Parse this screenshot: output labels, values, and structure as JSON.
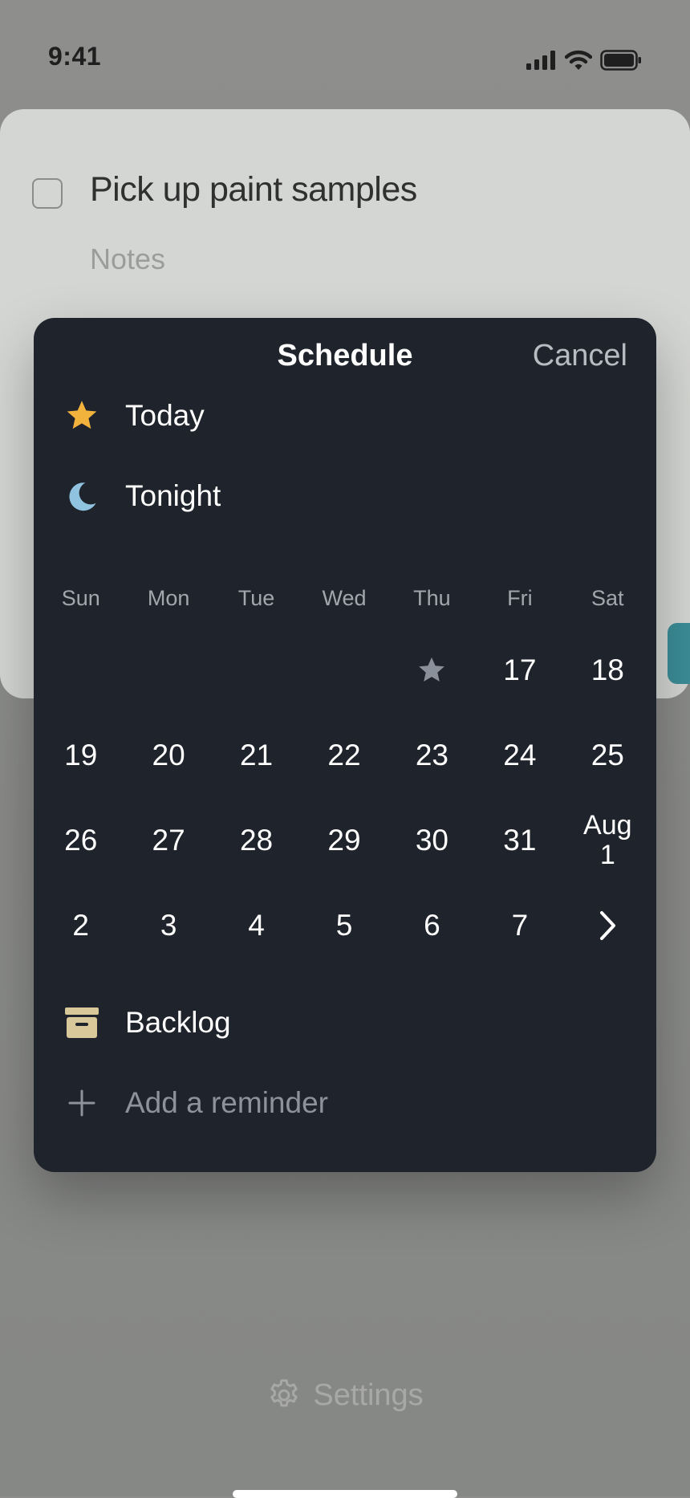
{
  "status_bar": {
    "time": "9:41"
  },
  "task": {
    "title": "Pick up paint samples",
    "notes_placeholder": "Notes"
  },
  "schedule": {
    "title": "Schedule",
    "cancel_label": "Cancel",
    "today_label": "Today",
    "tonight_label": "Tonight",
    "weekdays": [
      "Sun",
      "Mon",
      "Tue",
      "Wed",
      "Thu",
      "Fri",
      "Sat"
    ],
    "weeks": [
      [
        "",
        "",
        "",
        "",
        "star-icon",
        "17",
        "18"
      ],
      [
        "19",
        "20",
        "21",
        "22",
        "23",
        "24",
        "25"
      ],
      [
        "26",
        "27",
        "28",
        "29",
        "30",
        "31",
        "Aug 1"
      ],
      [
        "2",
        "3",
        "4",
        "5",
        "6",
        "7",
        "chevron-right-icon"
      ]
    ],
    "backlog_label": "Backlog",
    "add_reminder_label": "Add a reminder"
  },
  "footer": {
    "settings_label": "Settings"
  },
  "colors": {
    "sheet_background": "#1f232b",
    "today_star": "#f2b33d",
    "tonight_moon": "#8fc3df",
    "backlog_box": "#d9c89a",
    "accent_teal": "#3b8d97"
  }
}
